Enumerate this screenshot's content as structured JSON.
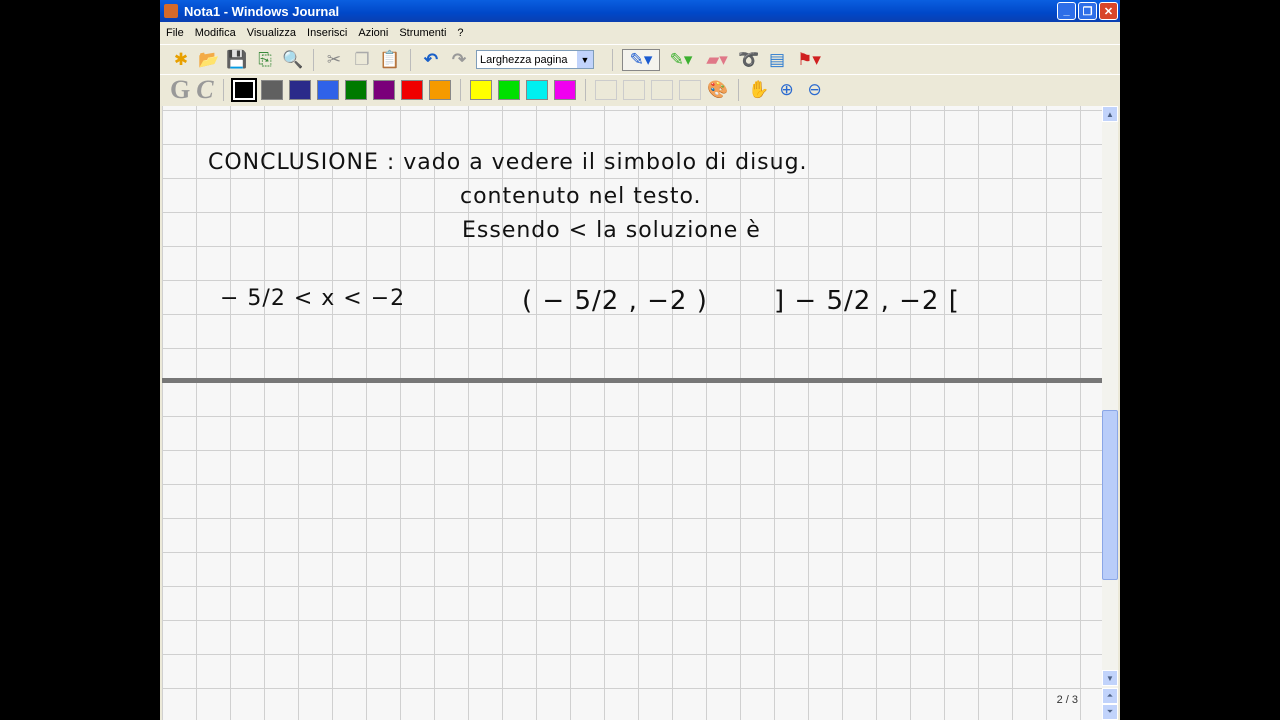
{
  "window": {
    "title": "Nota1 - Windows Journal"
  },
  "menu": [
    "File",
    "Modifica",
    "Visualizza",
    "Inserisci",
    "Azioni",
    "Strumenti",
    "?"
  ],
  "toolbar": {
    "zoom_value": "Larghezza pagina"
  },
  "colors": [
    "#000000",
    "#606060",
    "#2a2a8a",
    "#2f62e8",
    "#007a00",
    "#7a007a",
    "#f00000",
    "#f59a00",
    "#ffff00",
    "#00e000",
    "#00f0f0",
    "#f000f0"
  ],
  "note": {
    "line1": "CONCLUSIONE : vado a vedere il simbolo di disug.",
    "line2": "contenuto nel testo.",
    "line3": "Essendo < la soluzione è",
    "expr1": "− 5/2 < x < −2",
    "expr2": "( − 5/2 , −2 )",
    "expr3": "] − 5/2 , −2 ["
  },
  "status": {
    "page": "2 / 3"
  }
}
